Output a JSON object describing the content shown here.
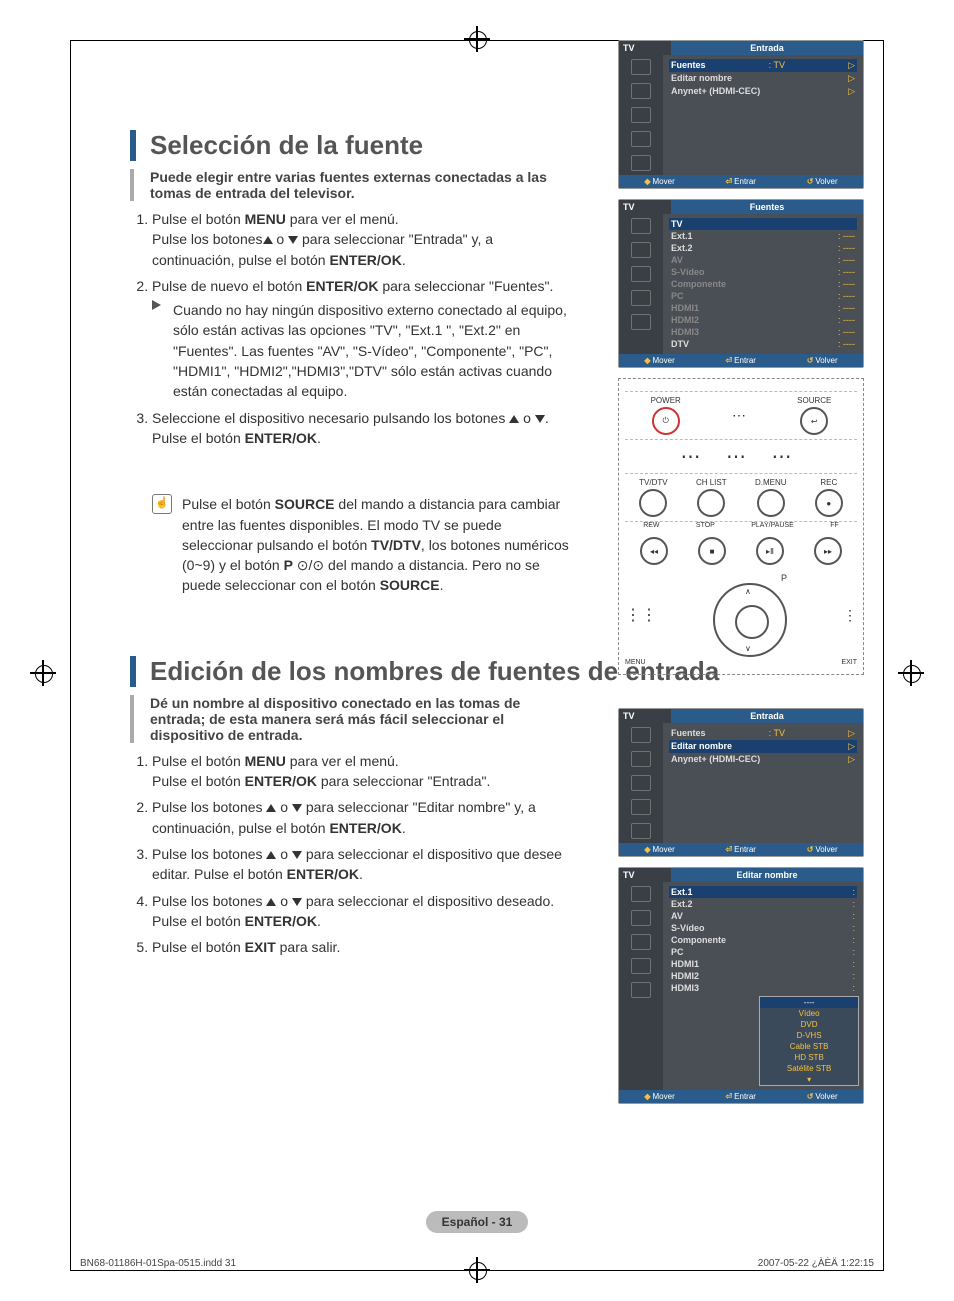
{
  "section1": {
    "title": "Selección de la fuente",
    "intro": "Puede elegir entre varias fuentes externas conectadas a las tomas de entrada del televisor.",
    "step1_a": "Pulse el botón ",
    "step1_b": "MENU",
    "step1_c": " para ver el menú.",
    "step1_d": "Pulse los botones",
    "step1_e": " para seleccionar \"Entrada\" y, a continuación, pulse el botón ",
    "step1_f": "ENTER/OK",
    "step1_g": ".",
    "step2_a": "Pulse de nuevo el botón ",
    "step2_b": "ENTER/OK",
    "step2_c": " para seleccionar \"Fuentes\".",
    "step2_note": "Cuando no hay ningún dispositivo externo conectado al equipo, sólo están activas las opciones \"TV\", \"Ext.1 \", \"Ext.2\" en \"Fuentes\". Las fuentes \"AV\", \"S-Vídeo\", \"Componente\", \"PC\", \"HDMI1\", \"HDMI2\",\"HDMI3\",\"DTV\" sólo están activas cuando están conectadas al equipo.",
    "step3_a": "Seleccione el dispositivo necesario pulsando los botones ",
    "step3_b": "Pulse el botón ",
    "step3_c": "ENTER/OK",
    "step3_d": ".",
    "tip_a": "Pulse el botón ",
    "tip_b": "SOURCE",
    "tip_c": " del mando a distancia para cambiar entre las fuentes disponibles. El modo TV se puede seleccionar pulsando el botón ",
    "tip_d": "TV/DTV",
    "tip_e": ", los botones numéricos (0~9) y el botón ",
    "tip_f": "P",
    "tip_g": " del mando a distancia. Pero no se puede seleccionar con el botón ",
    "tip_h": "SOURCE",
    "tip_i": "."
  },
  "section2": {
    "title": "Edición de los nombres de fuentes de entrada",
    "intro": "Dé un nombre al dispositivo conectado en las tomas de entrada; de esta manera será más fácil seleccionar el dispositivo de entrada.",
    "s1_a": "Pulse el botón ",
    "s1_b": "MENU",
    "s1_c": " para ver el menú.",
    "s1_d": "Pulse el botón ",
    "s1_e": "ENTER/OK",
    "s1_f": " para seleccionar \"Entrada\".",
    "s2_a": "Pulse los botones ",
    "s2_b": " para seleccionar \"Editar nombre\" y, a continuación, pulse el botón ",
    "s2_c": "ENTER/OK",
    "s2_d": ".",
    "s3_a": "Pulse los botones ",
    "s3_b": " para seleccionar el dispositivo que desee editar. Pulse el botón ",
    "s3_c": "ENTER/OK",
    "s3_d": ".",
    "s4_a": "Pulse los botones ",
    "s4_b": " para seleccionar el dispositivo deseado.",
    "s4_c": "Pulse el botón ",
    "s4_d": "ENTER/OK",
    "s4_e": ".",
    "s5_a": "Pulse el botón ",
    "s5_b": "EXIT",
    "s5_c": " para salir."
  },
  "tv": {
    "tv_label": "TV",
    "entrada_title": "Entrada",
    "fuentes_title": "Fuentes",
    "editar_title": "Editar nombre",
    "row_fuentes": "Fuentes",
    "row_fuentes_v": ": TV",
    "row_editar": "Editar nombre",
    "row_anynet": "Anynet+ (HDMI-CEC)",
    "mover": "Mover",
    "entrar": "Entrar",
    "volver": "Volver",
    "src": {
      "tv": "TV",
      "e1": "Ext.1",
      "e2": "Ext.2",
      "av": "AV",
      "sv": "S-Vídeo",
      "cp": "Componente",
      "pc": "PC",
      "h1": "HDMI1",
      "h2": "HDMI2",
      "h3": "HDMI3",
      "dtv": "DTV",
      "dash": ": ----"
    },
    "names": {
      "dash": "----",
      "video": "Vídeo",
      "dvd": "DVD",
      "dvhs": "D-VHS",
      "cable": "Cable STB",
      "hd": "HD STB",
      "sat": "Satélite STB"
    },
    "remote": {
      "power": "POWER",
      "source": "SOURCE",
      "tvdtv": "TV/DTV",
      "chlist": "CH LIST",
      "dmenu": "D.MENU",
      "rec": "REC",
      "rew": "REW",
      "stop": "STOP",
      "play": "PLAY/PAUSE",
      "ff": "FF",
      "p": "P",
      "menu": "MENU",
      "exit": "EXIT"
    }
  },
  "footer": {
    "page_label": "Español - 31",
    "file": "BN68-01186H-01Spa-0515.indd   31",
    "date": "2007-05-22   ¿ÀÈÄ 1:22:15"
  }
}
